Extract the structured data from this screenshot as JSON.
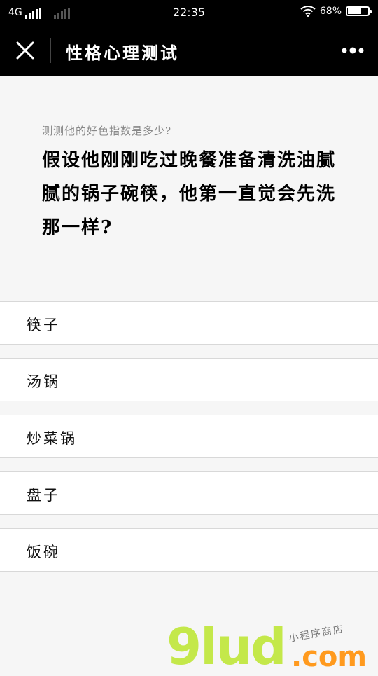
{
  "status_bar": {
    "network": "4G",
    "time": "22:35",
    "battery": "68%",
    "battery_level": 0.68
  },
  "nav": {
    "title": "性格心理测试",
    "close_icon": "close-icon",
    "more_icon": "more-horizontal-icon"
  },
  "question": {
    "subtitle": "测测他的好色指数是多少?",
    "text": "假设他刚刚吃过晚餐准备清洗油腻腻的锅子碗筷，他第一直觉会先洗那一样?"
  },
  "options": [
    {
      "label": "筷子"
    },
    {
      "label": "汤锅"
    },
    {
      "label": "炒菜锅"
    },
    {
      "label": "盘子"
    },
    {
      "label": "饭碗"
    }
  ],
  "watermark": {
    "main": "9lud",
    "suffix": ".com",
    "tagline": "小程序商店"
  },
  "colors": {
    "header_bg": "#000000",
    "page_bg": "#f6f6f6",
    "watermark_green": "#c4e84a",
    "watermark_orange": "#ff9a1e"
  }
}
